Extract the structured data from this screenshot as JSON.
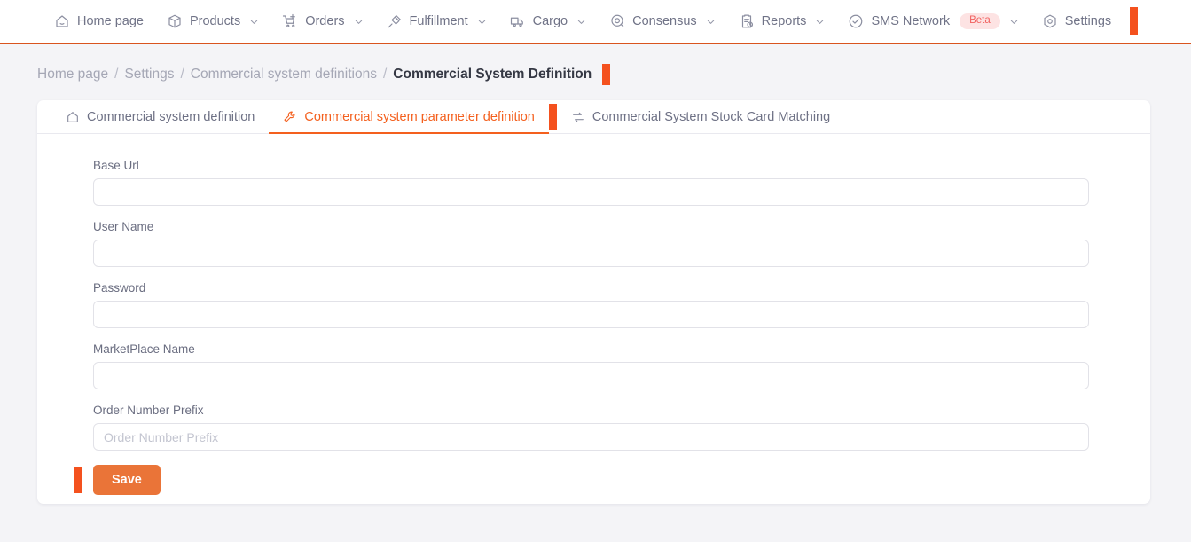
{
  "topnav": {
    "items": [
      {
        "label": "Home page",
        "icon": "home-icon",
        "caret": false,
        "badge": null
      },
      {
        "label": "Products",
        "icon": "box-icon",
        "caret": true,
        "badge": null
      },
      {
        "label": "Orders",
        "icon": "cart-plus-icon",
        "caret": true,
        "badge": null
      },
      {
        "label": "Fulfillment",
        "icon": "pin-icon",
        "caret": true,
        "badge": null
      },
      {
        "label": "Cargo",
        "icon": "truck-icon",
        "caret": true,
        "badge": null
      },
      {
        "label": "Consensus",
        "icon": "target-icon",
        "caret": true,
        "badge": null
      },
      {
        "label": "Reports",
        "icon": "clipboard-clock-icon",
        "caret": true,
        "badge": null
      },
      {
        "label": "SMS Network",
        "icon": "check-circle-icon",
        "caret": true,
        "badge": "Beta"
      },
      {
        "label": "Settings",
        "icon": "hex-gear-icon",
        "caret": false,
        "badge": null
      }
    ],
    "border_color": "#d9541e",
    "badge_bg": "#fde3e3",
    "badge_color": "#f1615f"
  },
  "breadcrumb": {
    "items": [
      "Home page",
      "Settings",
      "Commercial system definitions"
    ],
    "separator": "/",
    "current": "Commercial System Definition"
  },
  "tabs": [
    {
      "label": "Commercial system definition",
      "icon": "home-outline-icon",
      "active": false
    },
    {
      "label": "Commercial system parameter definition",
      "icon": "wrench-icon",
      "active": true
    },
    {
      "label": "Commercial System Stock Card Matching",
      "icon": "exchange-icon",
      "active": false
    }
  ],
  "form": {
    "fields": [
      {
        "label": "Base Url",
        "value": "",
        "placeholder": ""
      },
      {
        "label": "User Name",
        "value": "",
        "placeholder": ""
      },
      {
        "label": "Password",
        "value": "",
        "placeholder": ""
      },
      {
        "label": "MarketPlace Name",
        "value": "",
        "placeholder": ""
      },
      {
        "label": "Order Number Prefix",
        "value": "",
        "placeholder": "Order Number Prefix"
      }
    ],
    "save_label": "Save",
    "save_color": "#ea7438"
  },
  "markers": {
    "color": "#f4511e"
  }
}
